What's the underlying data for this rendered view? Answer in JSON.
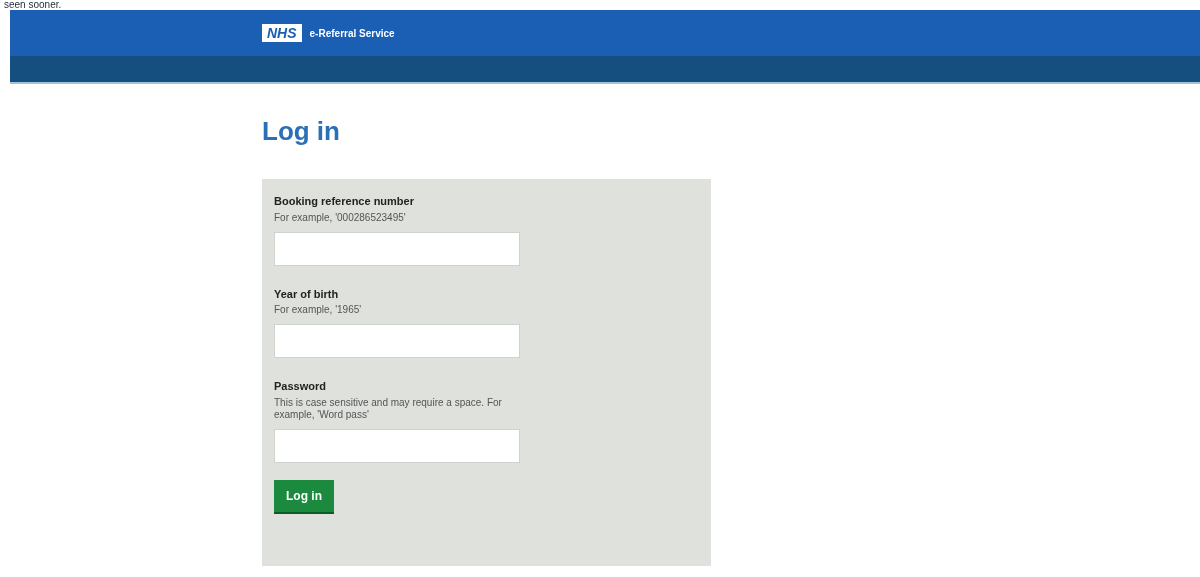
{
  "top_text": "seen sooner.",
  "header": {
    "logo": "NHS",
    "service_name": "e-Referral Service"
  },
  "page_title": "Log in",
  "fields": [
    {
      "label": "Booking reference number",
      "hint": "For example, '000286523495'"
    },
    {
      "label": "Year of birth",
      "hint": "For example, '1965'"
    },
    {
      "label": "Password",
      "hint": "This is case sensitive and may require a space. For example, 'Word pass'"
    }
  ],
  "submit_button": "Log in"
}
